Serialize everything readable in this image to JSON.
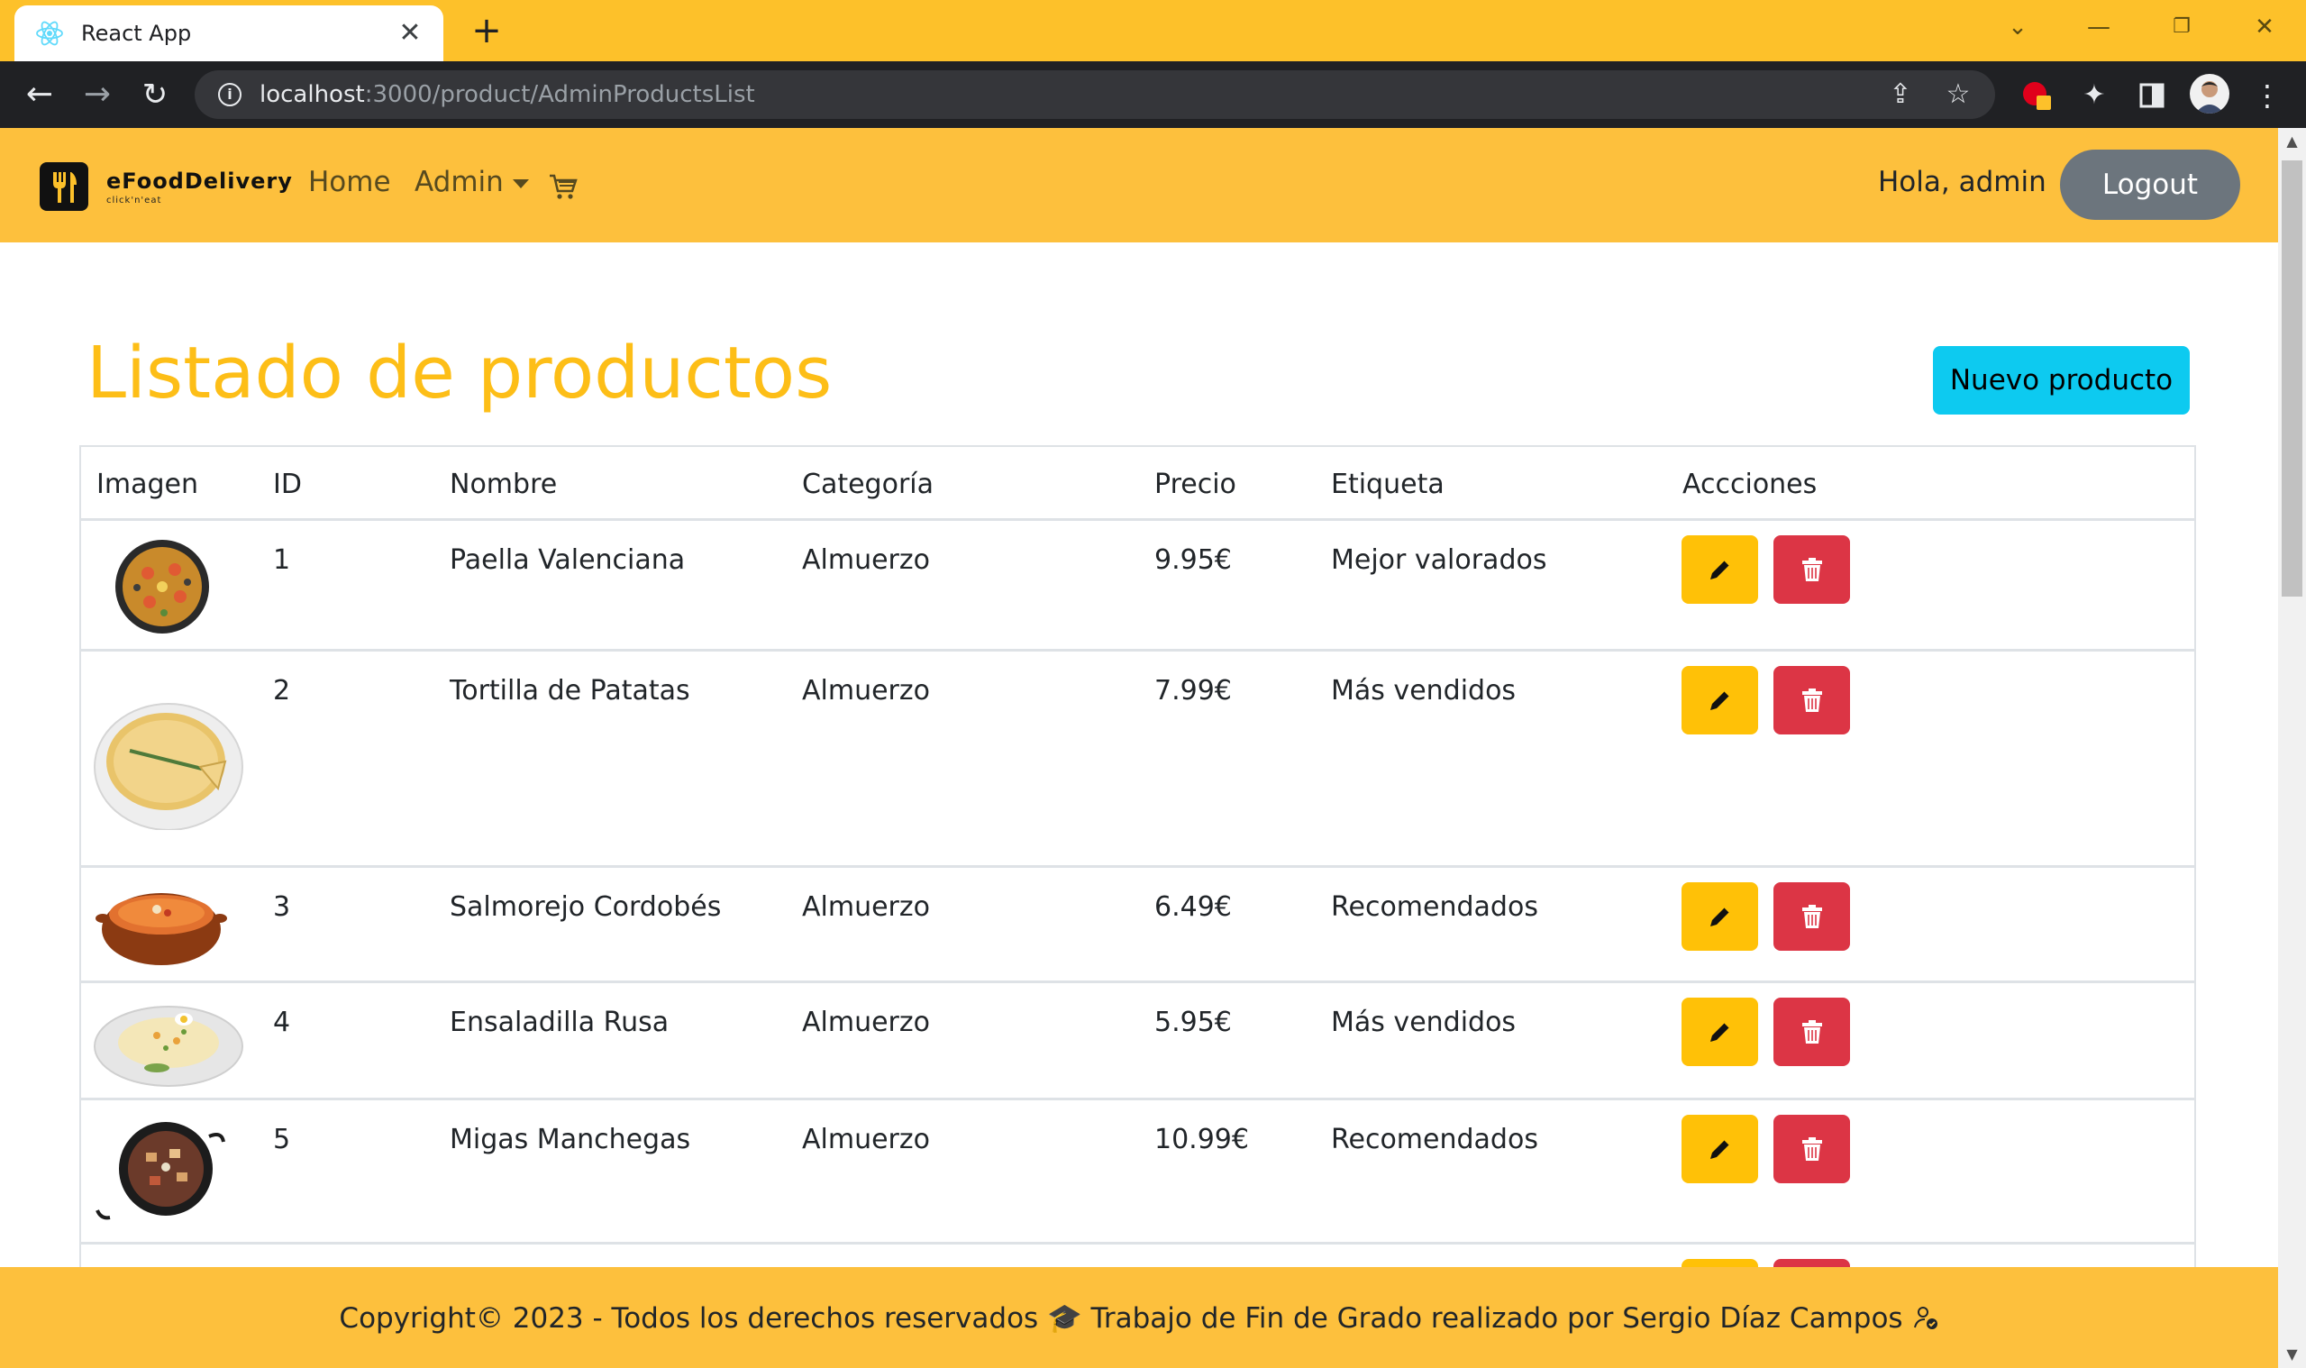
{
  "browser": {
    "tab_title": "React App",
    "url_host": "localhost",
    "url_rest": ":3000/product/AdminProductsList"
  },
  "navbar": {
    "brand_name": "eFoodDelivery",
    "brand_tagline": "click'n'eat",
    "home_label": "Home",
    "admin_label": "Admin",
    "greeting": "Hola, admin",
    "logout_label": "Logout"
  },
  "page": {
    "title": "Listado de productos",
    "new_product_label": "Nuevo producto"
  },
  "table": {
    "headers": [
      "Imagen",
      "ID",
      "Nombre",
      "Categoría",
      "Precio",
      "Etiqueta",
      "Accciones"
    ],
    "rows": [
      {
        "id": "1",
        "name": "Paella Valenciana",
        "category": "Almuerzo",
        "price": "9.95€",
        "tag": "Mejor valorados",
        "image": "paella-image"
      },
      {
        "id": "2",
        "name": "Tortilla de Patatas",
        "category": "Almuerzo",
        "price": "7.99€",
        "tag": "Más vendidos",
        "image": "tortilla-image"
      },
      {
        "id": "3",
        "name": "Salmorejo Cordobés",
        "category": "Almuerzo",
        "price": "6.49€",
        "tag": "Recomendados",
        "image": "salmorejo-image"
      },
      {
        "id": "4",
        "name": "Ensaladilla Rusa",
        "category": "Almuerzo",
        "price": "5.95€",
        "tag": "Más vendidos",
        "image": "ensaladilla-image"
      },
      {
        "id": "5",
        "name": "Migas Manchegas",
        "category": "Almuerzo",
        "price": "10.99€",
        "tag": "Recomendados",
        "image": "migas-image"
      }
    ]
  },
  "footer": {
    "text": "Copyright© 2023 - Todos los derechos reservados 🎓 Trabajo de Fin de Grado realizado por Sergio Díaz Campos"
  },
  "colors": {
    "brand_yellow": "#fdc03d",
    "title_yellow": "#fdbe17",
    "edit_button": "#ffc107",
    "delete_button": "#dc3545",
    "new_button": "#0dcaf0",
    "logout_button": "#6c757d"
  }
}
